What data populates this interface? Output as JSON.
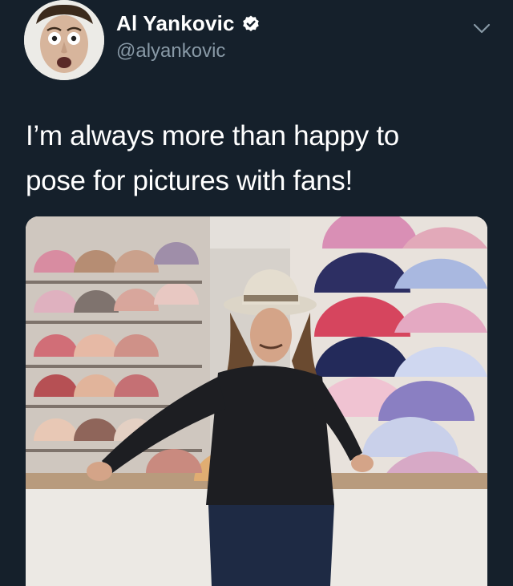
{
  "tweet": {
    "author": {
      "display_name": "Al Yankovic",
      "handle": "@alyankovic",
      "verified": true
    },
    "text_line_1": "I’m always more than happy to",
    "text_line_2": "pose for pictures with fans!",
    "media": {
      "type": "photo"
    }
  },
  "icons": {
    "verified": "verified-badge-icon",
    "menu": "chevron-down-icon"
  },
  "colors": {
    "background": "#15202b",
    "secondary_text": "#8899a6",
    "primary_text": "#ffffff"
  }
}
